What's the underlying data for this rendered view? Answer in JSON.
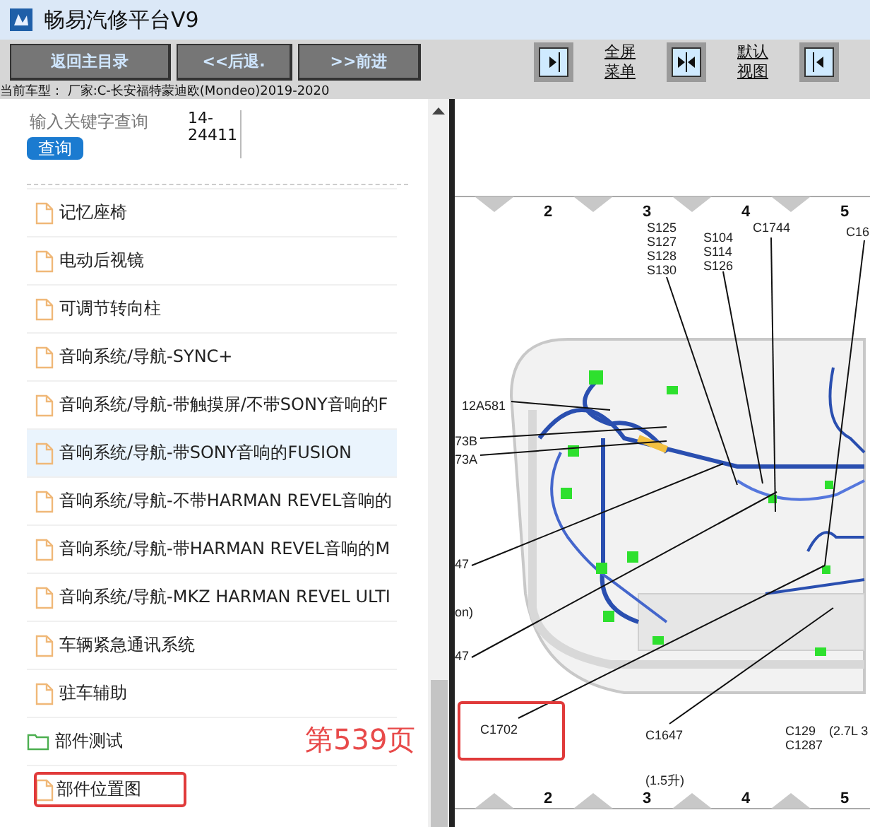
{
  "window": {
    "title": "畅易汽修平台V9"
  },
  "nav_buttons": [
    "返回主目录",
    "<<后退.",
    ">>前进"
  ],
  "toolbar_items": [
    {
      "kind": "arrow-right"
    },
    {
      "kind": "link",
      "lines": [
        "全屏",
        "菜单"
      ]
    },
    {
      "kind": "arrows-inward"
    },
    {
      "kind": "link",
      "lines": [
        "默认",
        "视图"
      ]
    },
    {
      "kind": "arrow-left"
    }
  ],
  "car_model": "当前车型： 厂家:C-长安福特蒙迪欧(Mondeo)2019-2020",
  "search": {
    "placeholder": "输入关键字查询",
    "button": "查询",
    "code": [
      "14-",
      "24411"
    ]
  },
  "items": [
    {
      "kind": "file",
      "label": "记忆座椅",
      "selected": false,
      "marked": false
    },
    {
      "kind": "file",
      "label": "电动后视镜",
      "selected": false,
      "marked": false
    },
    {
      "kind": "file",
      "label": "可调节转向柱",
      "selected": false,
      "marked": false
    },
    {
      "kind": "file",
      "label": "音响系统/导航-SYNC+",
      "selected": false,
      "marked": false
    },
    {
      "kind": "file",
      "label": "音响系统/导航-带触摸屏/不带SONY音响的F",
      "selected": false,
      "marked": false
    },
    {
      "kind": "file",
      "label": "音响系统/导航-带SONY音响的FUSION",
      "selected": true,
      "marked": false
    },
    {
      "kind": "file",
      "label": "音响系统/导航-不带HARMAN REVEL音响的",
      "selected": false,
      "marked": false
    },
    {
      "kind": "file",
      "label": "音响系统/导航-带HARMAN REVEL音响的M",
      "selected": false,
      "marked": false
    },
    {
      "kind": "file",
      "label": "音响系统/导航-MKZ HARMAN REVEL ULTI",
      "selected": false,
      "marked": false
    },
    {
      "kind": "file",
      "label": "车辆紧急通讯系统",
      "selected": false,
      "marked": false
    },
    {
      "kind": "file",
      "label": "驻车辅助",
      "selected": false,
      "marked": false
    },
    {
      "kind": "folder",
      "label": "部件测试",
      "selected": false,
      "marked": false
    },
    {
      "kind": "file",
      "label": "部件位置图",
      "selected": false,
      "marked": true
    }
  ],
  "page_note": "第539页",
  "diagram": {
    "top_ruler": [
      "2",
      "3",
      "4",
      "5"
    ],
    "labels": [
      {
        "lines": [
          "S125",
          "S127",
          "S128",
          "S130"
        ],
        "marked": false
      },
      {
        "lines": [
          "S104",
          "S114",
          "S126"
        ],
        "marked": false
      },
      {
        "lines": [
          "C1744"
        ],
        "marked": false
      },
      {
        "lines": [
          "C16"
        ],
        "marked": false
      },
      {
        "lines": [
          "12A581"
        ],
        "marked": false
      },
      {
        "lines": [
          "73B"
        ],
        "marked": false
      },
      {
        "lines": [
          "73A"
        ],
        "marked": false
      },
      {
        "lines": [
          "47"
        ],
        "marked": false
      },
      {
        "lines": [
          "on)"
        ],
        "marked": false
      },
      {
        "lines": [
          "47"
        ],
        "marked": false
      },
      {
        "lines": [
          "C1702"
        ],
        "marked": true
      },
      {
        "lines": [
          "C1647"
        ],
        "marked": false
      },
      {
        "lines": [
          "C129",
          "C1287"
        ],
        "marked": false
      },
      {
        "lines": [
          "(2.7L 3"
        ],
        "marked": false
      },
      {
        "lines": [
          "(1.5升)"
        ],
        "marked": false
      }
    ],
    "bottom_ruler": [
      "2",
      "3",
      "4",
      "5"
    ]
  }
}
